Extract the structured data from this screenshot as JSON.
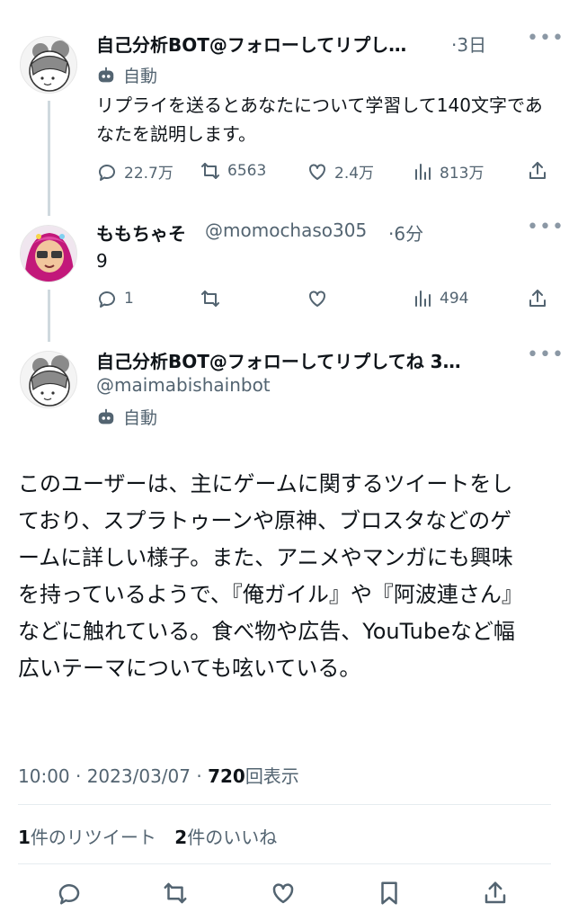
{
  "tweet1": {
    "name": "自己分析BOT@フォローしてリプし…",
    "time": "·3日",
    "auto_label": "自動",
    "text": "リプライを送るとあなたについて学習して140文字であなたを説明します。",
    "replies": "22.7万",
    "retweets": "6563",
    "likes": "2.4万",
    "views": "813万"
  },
  "tweet2": {
    "name": "ももちゃそ",
    "handle": "@momochaso305",
    "time": "·6分",
    "text": "9",
    "replies": "1",
    "views": "494"
  },
  "tweet3": {
    "name": "自己分析BOT@フォローしてリプしてね 3…",
    "handle": "@maimabishainbot",
    "auto_label": "自動",
    "text": "このユーザーは、主にゲームに関するツイートをしており、スプラトゥーンや原神、ブロスタなどのゲームに詳しい様子。また、アニメやマンガにも興味を持っているようで、『俺ガイル』や『阿波連さん』などに触れている。食べ物や広告、YouTubeなど幅広いテーマについても呟いている。",
    "timestamp": "10:00 · 2023/03/07 · ",
    "view_count": "720",
    "view_label": "回表示"
  },
  "stats": {
    "retweet_count": "1",
    "retweet_label": "件のリツイート",
    "like_count": "2",
    "like_label": "件のいいね"
  },
  "icons": [
    "reply-icon",
    "retweet-icon",
    "like-icon",
    "views-icon",
    "share-icon",
    "bookmark-icon",
    "more-icon",
    "bot-icon"
  ],
  "colors": {
    "text": "#0f1419",
    "secondary": "#536471",
    "divider": "#e6ecf0"
  }
}
